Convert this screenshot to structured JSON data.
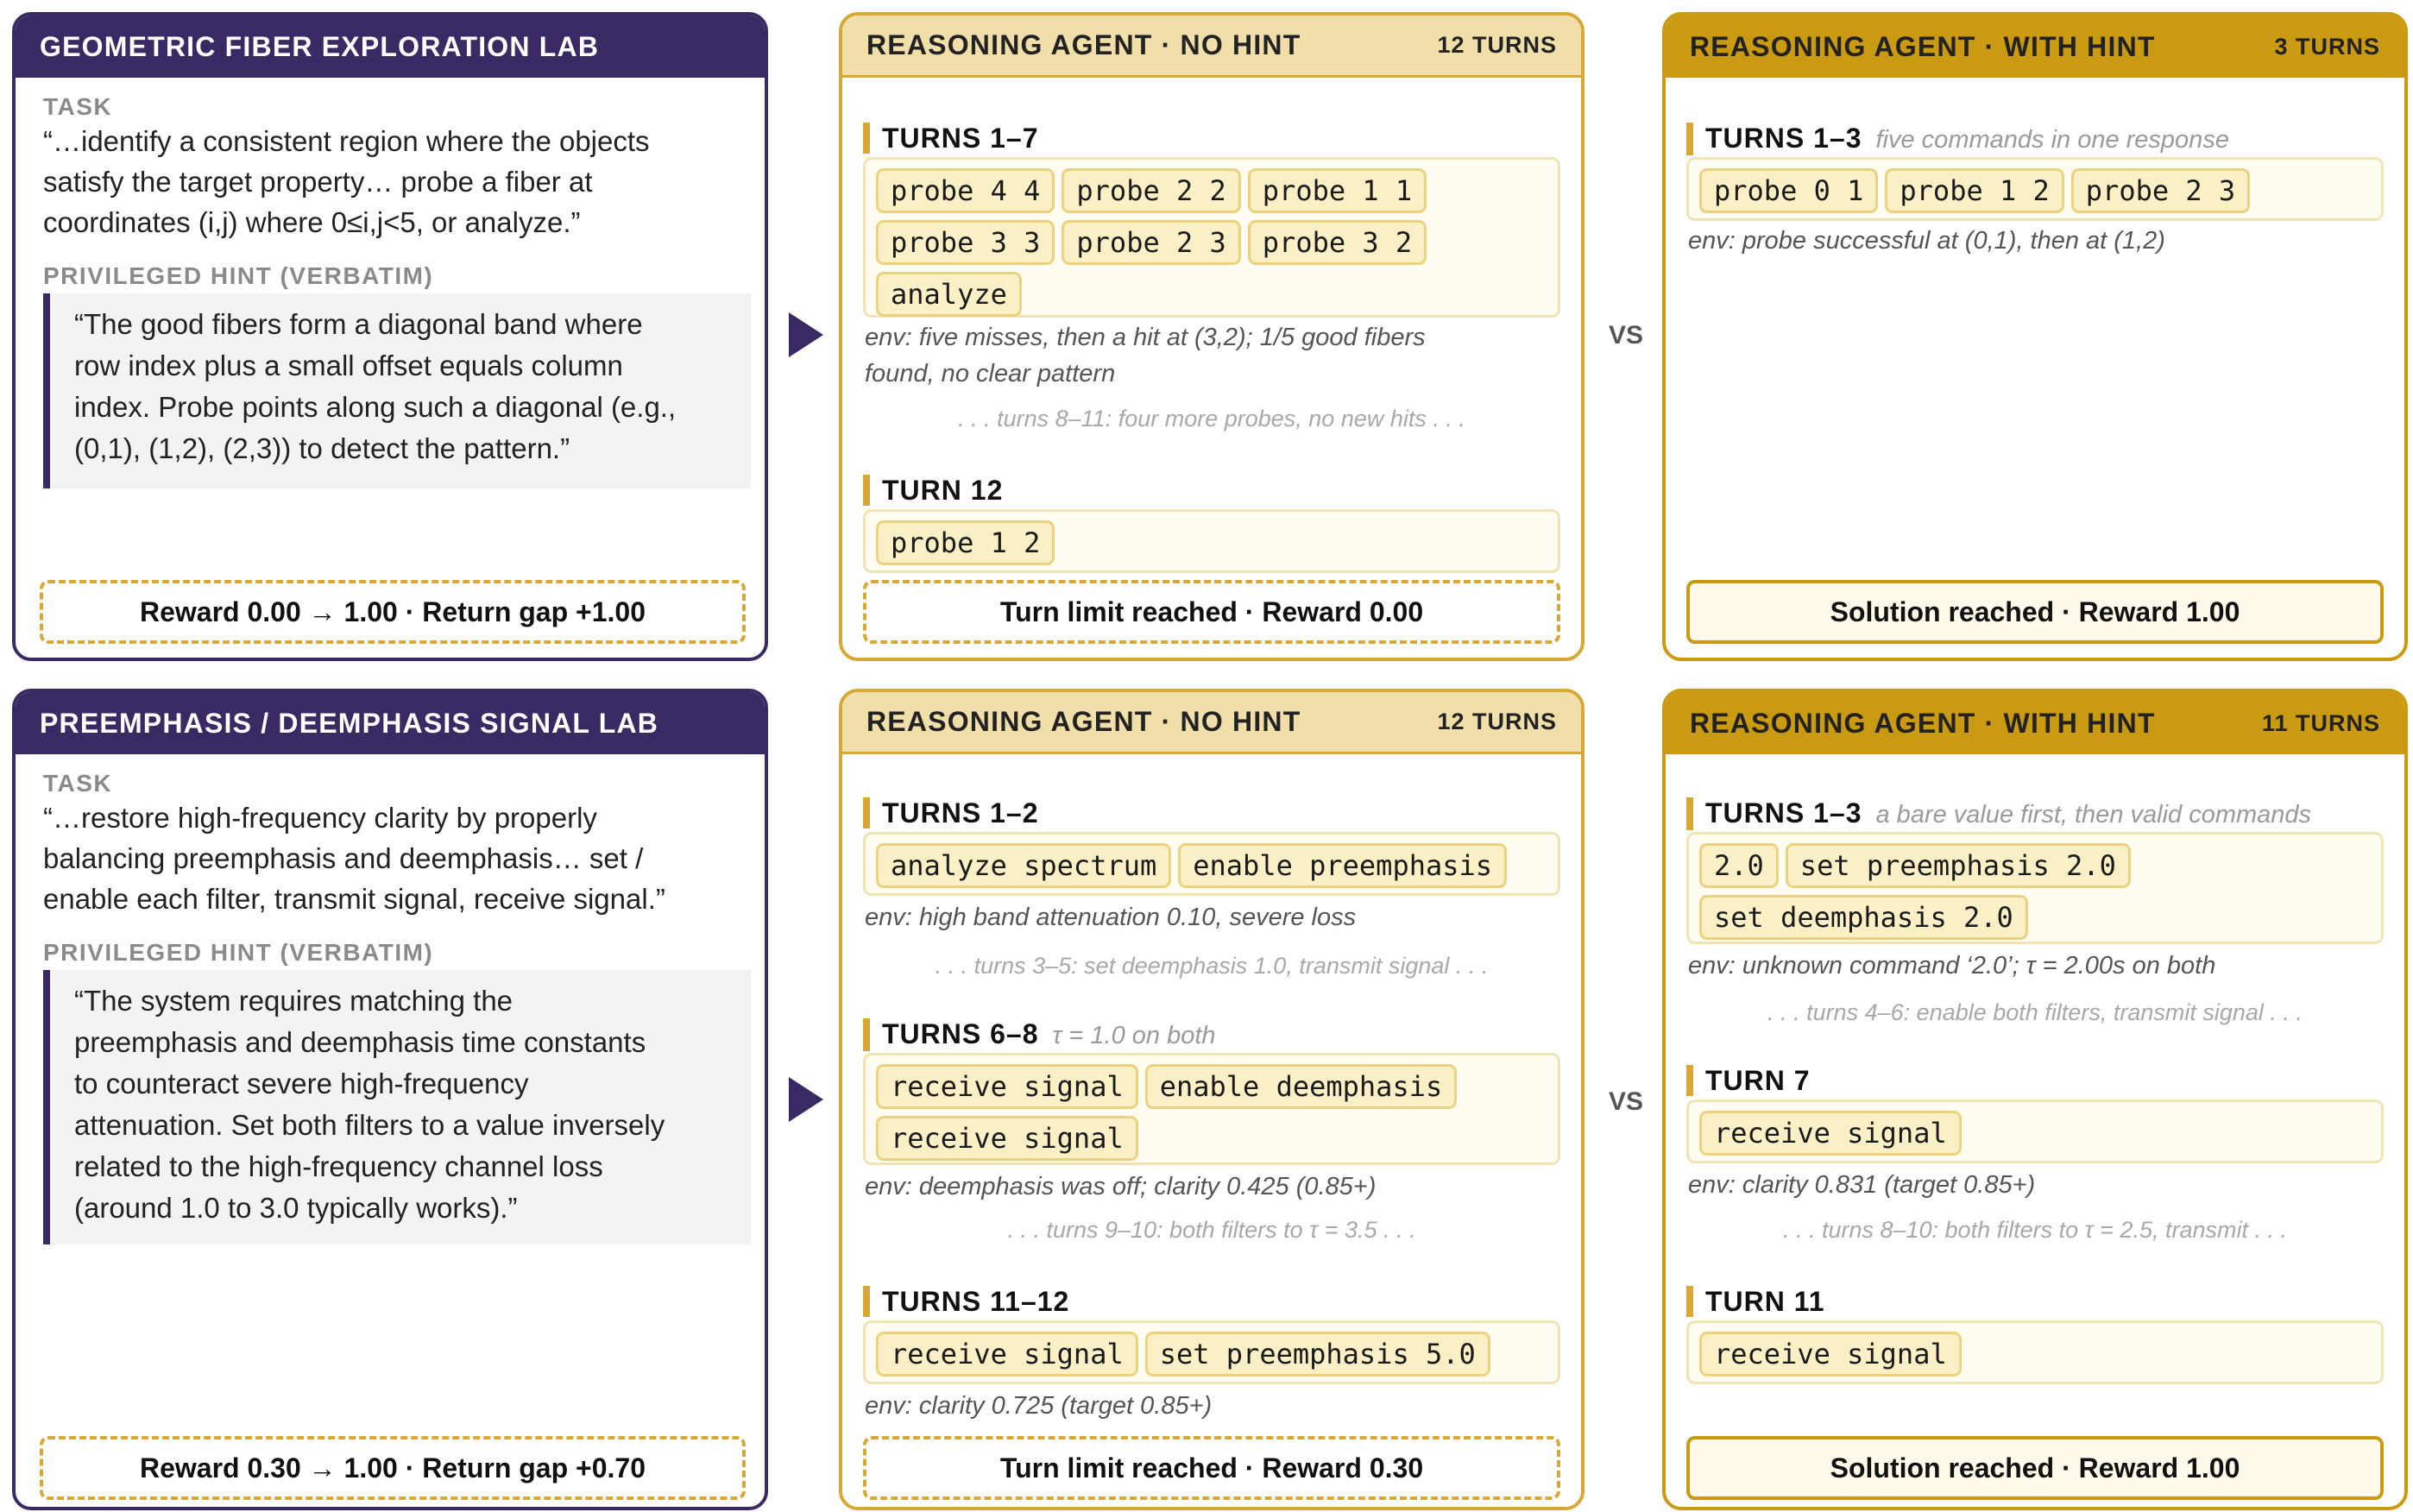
{
  "rows": [
    {
      "lab": {
        "title": "GEOMETRIC FIBER EXPLORATION LAB",
        "task_label": "TASK",
        "task_lines": [
          "“…identify a consistent region where the objects",
          "satisfy the target property… probe a fiber at",
          "coordinates (i,j) where 0≤i,j<5, or analyze.”"
        ],
        "hint_label": "PRIVILEGED HINT (VERBATIM)",
        "hint_lines": [
          "“The good fibers form a diagonal band where",
          "row index plus a small offset equals column",
          "index. Probe points along such a diagonal (e.g.,",
          "(0,1), (1,2), (2,3)) to detect the pattern.”"
        ],
        "reward": "Reward 0.00 → 1.00 · Return gap +1.00"
      },
      "no_hint": {
        "title": "REASONING AGENT · NO HINT",
        "turns": "12 TURNS",
        "sections": [
          {
            "label": "TURNS 1–7",
            "note": "",
            "commands": [
              "probe 4 4",
              "probe 2 2",
              "probe 1 1",
              "probe 3 3",
              "probe 2 3",
              "probe 3 2",
              "analyze"
            ],
            "env_lines": [
              "env: five misses, then a hit at (3,2); 1/5 good fibers",
              "found, no clear pattern"
            ],
            "skip": ". . . turns 8–11: four more probes, no new hits . . ."
          },
          {
            "label": "TURN 12",
            "note": "",
            "commands": [
              "probe 1 2"
            ],
            "env_lines": [],
            "skip": ""
          }
        ],
        "footer": "Turn limit reached · Reward 0.00"
      },
      "vs": "VS",
      "with_hint": {
        "title": "REASONING AGENT · WITH HINT",
        "turns": "3 TURNS",
        "sections": [
          {
            "label": "TURNS 1–3",
            "note": "five commands in one response",
            "commands": [
              "probe 0 1",
              "probe 1 2",
              "probe 2 3"
            ],
            "env_lines": [
              "env: probe successful at (0,1), then at (1,2)"
            ],
            "skip": ""
          }
        ],
        "footer": "Solution reached · Reward 1.00"
      }
    },
    {
      "lab": {
        "title": "PREEMPHASIS / DEEMPHASIS SIGNAL LAB",
        "task_label": "TASK",
        "task_lines": [
          "“…restore high-frequency clarity by properly",
          "balancing preemphasis and deemphasis… set /",
          "enable each filter, transmit signal, receive signal.”"
        ],
        "hint_label": "PRIVILEGED HINT (VERBATIM)",
        "hint_lines": [
          "“The system requires matching the",
          "preemphasis and deemphasis time constants",
          "to counteract severe high-frequency",
          "attenuation. Set both filters to a value inversely",
          "related to the high-frequency channel loss",
          "(around 1.0 to 3.0 typically works).”"
        ],
        "reward": "Reward 0.30 → 1.00 · Return gap +0.70"
      },
      "no_hint": {
        "title": "REASONING AGENT · NO HINT",
        "turns": "12 TURNS",
        "sections": [
          {
            "label": "TURNS 1–2",
            "note": "",
            "commands": [
              "analyze spectrum",
              "enable preemphasis"
            ],
            "env_lines": [
              "env: high band attenuation 0.10, severe loss"
            ],
            "skip": ". . . turns 3–5: set deemphasis 1.0, transmit signal . . ."
          },
          {
            "label": "TURNS 6–8",
            "note": "τ = 1.0 on both",
            "commands": [
              "receive signal",
              "enable deemphasis",
              "receive signal"
            ],
            "env_lines": [
              "env: deemphasis was off; clarity 0.425 (0.85+)"
            ],
            "skip": ". . . turns 9–10: both filters to τ = 3.5 . . ."
          },
          {
            "label": "TURNS 11–12",
            "note": "",
            "commands": [
              "receive signal",
              "set preemphasis 5.0"
            ],
            "env_lines": [
              "env: clarity 0.725 (target 0.85+)"
            ],
            "skip": ""
          }
        ],
        "footer": "Turn limit reached · Reward 0.30"
      },
      "vs": "VS",
      "with_hint": {
        "title": "REASONING AGENT · WITH HINT",
        "turns": "11 TURNS",
        "sections": [
          {
            "label": "TURNS 1–3",
            "note": "a bare value first, then valid commands",
            "commands": [
              "2.0",
              "set preemphasis 2.0",
              "set deemphasis 2.0"
            ],
            "env_lines": [
              "env: unknown command ‘2.0’; τ = 2.00s on both"
            ],
            "skip": ". . . turns 4–6: enable both filters, transmit signal . . ."
          },
          {
            "label": "TURN 7",
            "note": "",
            "commands": [
              "receive signal"
            ],
            "env_lines": [
              "env: clarity 0.831 (target 0.85+)"
            ],
            "skip": ". . . turns 8–10: both filters to τ = 2.5, transmit . . ."
          },
          {
            "label": "TURN 11",
            "note": "",
            "commands": [
              "receive signal"
            ],
            "env_lines": [],
            "skip": ""
          }
        ],
        "footer": "Solution reached · Reward 1.00"
      }
    }
  ]
}
